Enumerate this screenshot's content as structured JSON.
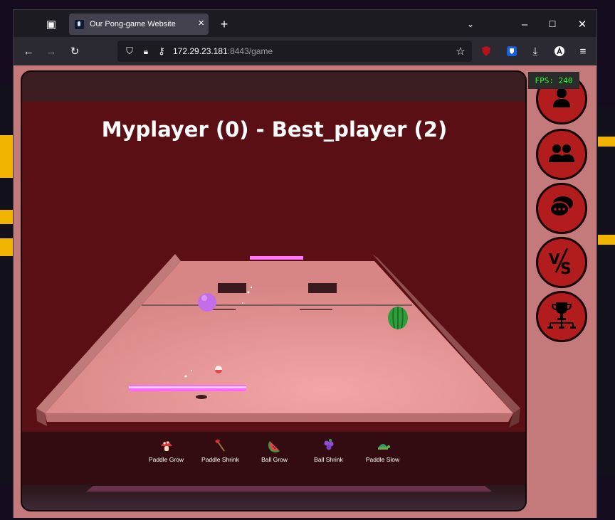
{
  "browser": {
    "tab_title": "Our Pong-game Website",
    "url_host": "172.29.23.181",
    "url_rest": ":8443/game",
    "icons": [
      "tab-overview-icon",
      "close-icon",
      "plus-icon",
      "chevron-down-icon",
      "minimize-icon",
      "maximize-icon",
      "window-close-icon",
      "back-icon",
      "forward-icon",
      "reload-icon",
      "shield-icon",
      "lock-icon",
      "key-icon",
      "star-icon",
      "ublock-icon",
      "bitwarden-icon",
      "download-icon",
      "account-icon",
      "menu-icon"
    ]
  },
  "game": {
    "score_text": "Myplayer (0) - Best_player (2)",
    "fps": "FPS: 240",
    "powerups": [
      {
        "label": "Paddle Grow",
        "icon": "mushroom-icon"
      },
      {
        "label": "Paddle Shrink",
        "icon": "axe-icon"
      },
      {
        "label": "Ball Grow",
        "icon": "watermelon-icon"
      },
      {
        "label": "Ball Shrink",
        "icon": "grapes-icon"
      },
      {
        "label": "Paddle Slow",
        "icon": "turtle-icon"
      }
    ]
  },
  "sidebar": {
    "buttons": [
      "profile-icon",
      "friends-icon",
      "chat-icon",
      "versus-icon",
      "tournament-icon"
    ]
  },
  "colors": {
    "accent_red": "#b21c1c",
    "table": "#e08d8d",
    "sky": "#5a0f14",
    "paddle": "#ff66ff",
    "fps_green": "#29ff29"
  }
}
